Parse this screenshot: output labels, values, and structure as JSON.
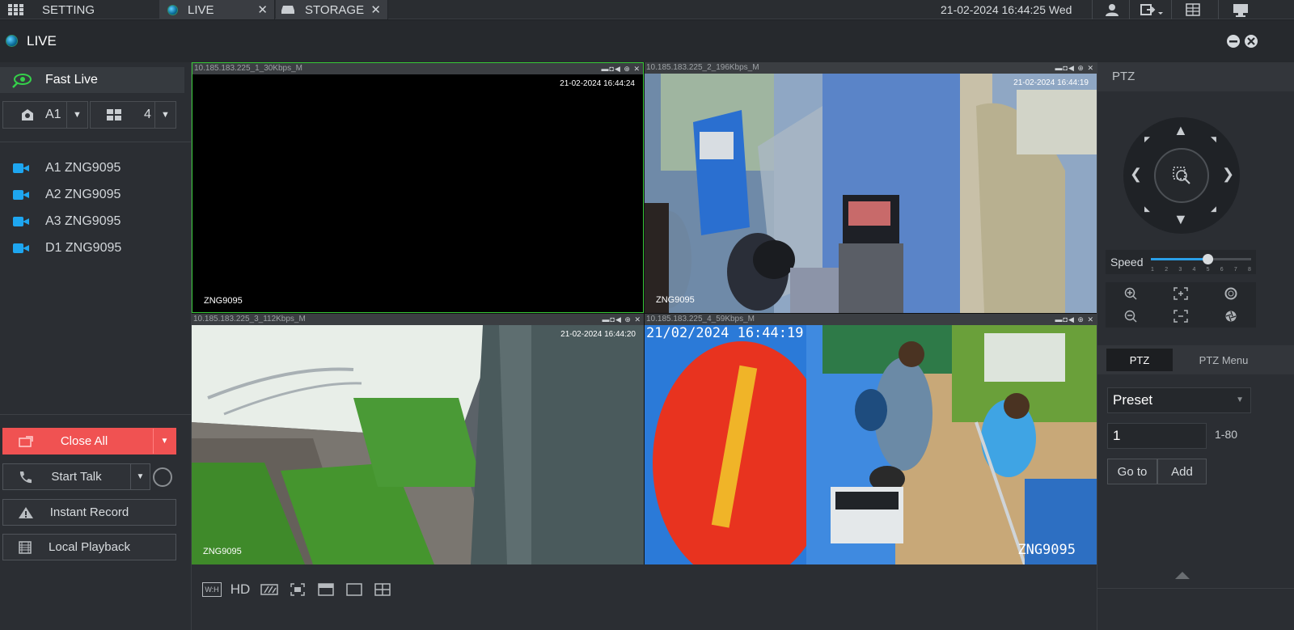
{
  "topbar": {
    "setting_label": "SETTING",
    "tabs": [
      {
        "label": "LIVE"
      },
      {
        "label": "STORAGE"
      }
    ],
    "close_glyph": "✕",
    "datetime": "21-02-2024 16:44:25 Wed"
  },
  "livebar": {
    "title": "LIVE"
  },
  "left": {
    "fast_live": "Fast Live",
    "group_value": "A1",
    "layout_value": "4",
    "cameras": [
      "A1 ZNG9095",
      "A2 ZNG9095",
      "A3 ZNG9095",
      "D1 ZNG9095"
    ],
    "close_all": "Close All",
    "start_talk": "Start Talk",
    "instant_record": "Instant Record",
    "local_playback": "Local Playback"
  },
  "videos": [
    {
      "header": "10.185.183.225_1_30Kbps_M",
      "timestamp": "21-02-2024 16:44:24",
      "name": "ZNG9095"
    },
    {
      "header": "10.185.183.225_2_196Kbps_M",
      "timestamp": "21-02-2024 16:44:19",
      "name": "ZNG9095"
    },
    {
      "header": "10.185.183.225_3_112Kbps_M",
      "timestamp": "21-02-2024 16:44:20",
      "name": "ZNG9095"
    },
    {
      "header": "10.185.183.225_4_59Kbps_M",
      "timestamp": "21/02/2024 16:44:19",
      "name": "ZNG9095"
    }
  ],
  "bottom_tools": {
    "wh": "W:H",
    "hd": "HD"
  },
  "ptz": {
    "title": "PTZ",
    "speed_label": "Speed",
    "speed_ticks": [
      "1",
      "2",
      "3",
      "4",
      "5",
      "6",
      "7",
      "8"
    ],
    "speed_value": 5,
    "tab_ptz": "PTZ",
    "tab_menu": "PTZ Menu",
    "preset": "Preset",
    "preset_number": "1",
    "range": "1-80",
    "goto": "Go to",
    "add": "Add"
  },
  "colors": {
    "accent": "#1ea6f0",
    "close_all": "#f05252",
    "active_border": "#37c837"
  }
}
